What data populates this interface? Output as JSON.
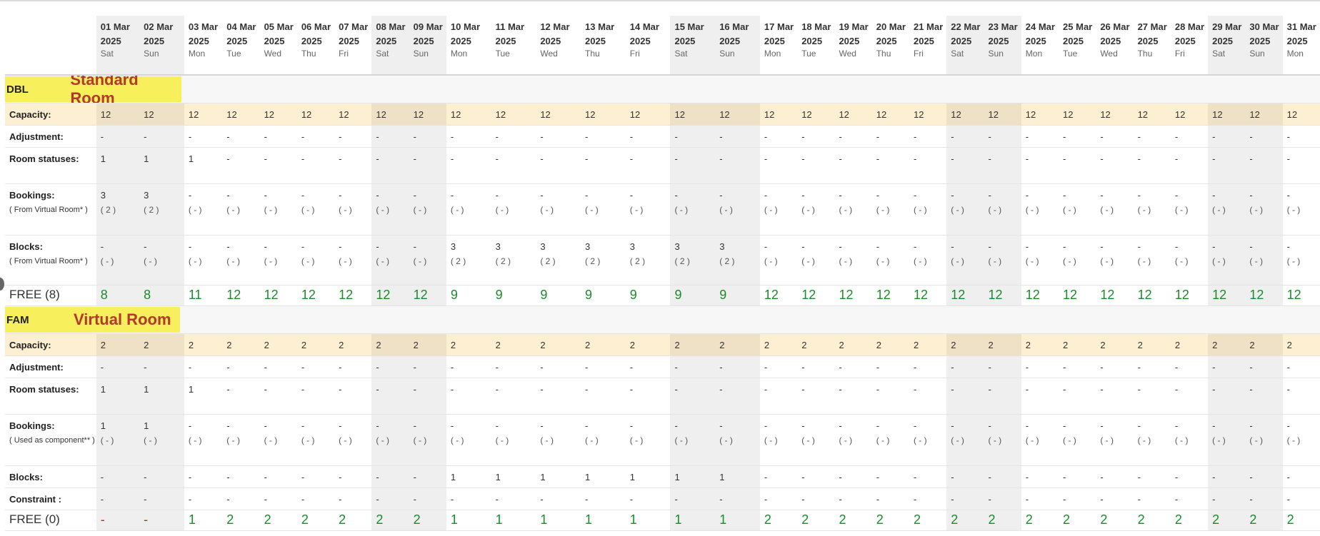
{
  "dates": [
    {
      "d": "01 Mar",
      "y": "2025",
      "w": "Sat",
      "wk": true
    },
    {
      "d": "02 Mar",
      "y": "2025",
      "w": "Sun",
      "wk": true
    },
    {
      "d": "03 Mar",
      "y": "2025",
      "w": "Mon",
      "wk": false
    },
    {
      "d": "04 Mar",
      "y": "2025",
      "w": "Tue",
      "wk": false
    },
    {
      "d": "05 Mar",
      "y": "2025",
      "w": "Wed",
      "wk": false
    },
    {
      "d": "06 Mar",
      "y": "2025",
      "w": "Thu",
      "wk": false
    },
    {
      "d": "07 Mar",
      "y": "2025",
      "w": "Fri",
      "wk": false
    },
    {
      "d": "08 Mar",
      "y": "2025",
      "w": "Sat",
      "wk": true
    },
    {
      "d": "09 Mar",
      "y": "2025",
      "w": "Sun",
      "wk": true
    },
    {
      "d": "10 Mar",
      "y": "2025",
      "w": "Mon",
      "wk": false
    },
    {
      "d": "11 Mar",
      "y": "2025",
      "w": "Tue",
      "wk": false
    },
    {
      "d": "12 Mar",
      "y": "2025",
      "w": "Wed",
      "wk": false
    },
    {
      "d": "13 Mar",
      "y": "2025",
      "w": "Thu",
      "wk": false
    },
    {
      "d": "14 Mar",
      "y": "2025",
      "w": "Fri",
      "wk": false
    },
    {
      "d": "15 Mar",
      "y": "2025",
      "w": "Sat",
      "wk": true
    },
    {
      "d": "16 Mar",
      "y": "2025",
      "w": "Sun",
      "wk": true
    },
    {
      "d": "17 Mar",
      "y": "2025",
      "w": "Mon",
      "wk": false
    },
    {
      "d": "18 Mar",
      "y": "2025",
      "w": "Tue",
      "wk": false
    },
    {
      "d": "19 Mar",
      "y": "2025",
      "w": "Wed",
      "wk": false
    },
    {
      "d": "20 Mar",
      "y": "2025",
      "w": "Thu",
      "wk": false
    },
    {
      "d": "21 Mar",
      "y": "2025",
      "w": "Fri",
      "wk": false
    },
    {
      "d": "22 Mar",
      "y": "2025",
      "w": "Sat",
      "wk": true
    },
    {
      "d": "23 Mar",
      "y": "2025",
      "w": "Sun",
      "wk": true
    },
    {
      "d": "24 Mar",
      "y": "2025",
      "w": "Mon",
      "wk": false
    },
    {
      "d": "25 Mar",
      "y": "2025",
      "w": "Tue",
      "wk": false
    },
    {
      "d": "26 Mar",
      "y": "2025",
      "w": "Wed",
      "wk": false
    },
    {
      "d": "27 Mar",
      "y": "2025",
      "w": "Thu",
      "wk": false
    },
    {
      "d": "28 Mar",
      "y": "2025",
      "w": "Fri",
      "wk": false
    },
    {
      "d": "29 Mar",
      "y": "2025",
      "w": "Sat",
      "wk": true
    },
    {
      "d": "30 Mar",
      "y": "2025",
      "w": "Sun",
      "wk": true
    },
    {
      "d": "31 Mar",
      "y": "2025",
      "w": "Mon",
      "wk": false
    }
  ],
  "sections": [
    {
      "code": "DBL",
      "name": "Standard Room",
      "rows": [
        {
          "type": "cap",
          "label": "Capacity:",
          "values": [
            "12",
            "12",
            "12",
            "12",
            "12",
            "12",
            "12",
            "12",
            "12",
            "12",
            "12",
            "12",
            "12",
            "12",
            "12",
            "12",
            "12",
            "12",
            "12",
            "12",
            "12",
            "12",
            "12",
            "12",
            "12",
            "12",
            "12",
            "12",
            "12",
            "12",
            "12"
          ]
        },
        {
          "type": "plain",
          "label": "Adjustment:",
          "values": [
            "-",
            "-",
            "-",
            "-",
            "-",
            "-",
            "-",
            "-",
            "-",
            "-",
            "-",
            "-",
            "-",
            "-",
            "-",
            "-",
            "-",
            "-",
            "-",
            "-",
            "-",
            "-",
            "-",
            "-",
            "-",
            "-",
            "-",
            "-",
            "-",
            "-",
            "-"
          ]
        },
        {
          "type": "plain",
          "label": "Room statuses:",
          "values": [
            "1",
            "1",
            "1",
            "-",
            "-",
            "-",
            "-",
            "-",
            "-",
            "-",
            "-",
            "-",
            "-",
            "-",
            "-",
            "-",
            "-",
            "-",
            "-",
            "-",
            "-",
            "-",
            "-",
            "-",
            "-",
            "-",
            "-",
            "-",
            "-",
            "-",
            "-"
          ]
        },
        {
          "type": "sub",
          "label": "Bookings:",
          "sublabel": "( From Virtual Room* )",
          "values": [
            "3",
            "3",
            "-",
            "-",
            "-",
            "-",
            "-",
            "-",
            "-",
            "-",
            "-",
            "-",
            "-",
            "-",
            "-",
            "-",
            "-",
            "-",
            "-",
            "-",
            "-",
            "-",
            "-",
            "-",
            "-",
            "-",
            "-",
            "-",
            "-",
            "-",
            "-"
          ],
          "subs": [
            "( 2 )",
            "( 2 )",
            "( - )",
            "( - )",
            "( - )",
            "( - )",
            "( - )",
            "( - )",
            "( - )",
            "( - )",
            "( - )",
            "( - )",
            "( - )",
            "( - )",
            "( - )",
            "( - )",
            "( - )",
            "( - )",
            "( - )",
            "( - )",
            "( - )",
            "( - )",
            "( - )",
            "( - )",
            "( - )",
            "( - )",
            "( - )",
            "( - )",
            "( - )",
            "( - )",
            "( - )"
          ]
        },
        {
          "type": "sub",
          "label": "Blocks:",
          "sublabel": "( From Virtual Room* )",
          "values": [
            "-",
            "-",
            "-",
            "-",
            "-",
            "-",
            "-",
            "-",
            "-",
            "3",
            "3",
            "3",
            "3",
            "3",
            "3",
            "3",
            "-",
            "-",
            "-",
            "-",
            "-",
            "-",
            "-",
            "-",
            "-",
            "-",
            "-",
            "-",
            "-",
            "-",
            "-"
          ],
          "subs": [
            "( - )",
            "( - )",
            "( - )",
            "( - )",
            "( - )",
            "( - )",
            "( - )",
            "( - )",
            "( - )",
            "( 2 )",
            "( 2 )",
            "( 2 )",
            "( 2 )",
            "( 2 )",
            "( 2 )",
            "( 2 )",
            "( - )",
            "( - )",
            "( - )",
            "( - )",
            "( - )",
            "( - )",
            "( - )",
            "( - )",
            "( - )",
            "( - )",
            "( - )",
            "( - )",
            "( - )",
            "( - )",
            "( - )"
          ]
        },
        {
          "type": "free",
          "label": "FREE (8)",
          "values": [
            "8",
            "8",
            "11",
            "12",
            "12",
            "12",
            "12",
            "12",
            "12",
            "9",
            "9",
            "9",
            "9",
            "9",
            "9",
            "9",
            "12",
            "12",
            "12",
            "12",
            "12",
            "12",
            "12",
            "12",
            "12",
            "12",
            "12",
            "12",
            "12",
            "12",
            "12"
          ]
        }
      ]
    },
    {
      "code": "FAM",
      "name": "Virtual Room",
      "rows": [
        {
          "type": "cap",
          "label": "Capacity:",
          "values": [
            "2",
            "2",
            "2",
            "2",
            "2",
            "2",
            "2",
            "2",
            "2",
            "2",
            "2",
            "2",
            "2",
            "2",
            "2",
            "2",
            "2",
            "2",
            "2",
            "2",
            "2",
            "2",
            "2",
            "2",
            "2",
            "2",
            "2",
            "2",
            "2",
            "2",
            "2"
          ]
        },
        {
          "type": "plain",
          "label": "Adjustment:",
          "values": [
            "-",
            "-",
            "-",
            "-",
            "-",
            "-",
            "-",
            "-",
            "-",
            "-",
            "-",
            "-",
            "-",
            "-",
            "-",
            "-",
            "-",
            "-",
            "-",
            "-",
            "-",
            "-",
            "-",
            "-",
            "-",
            "-",
            "-",
            "-",
            "-",
            "-",
            "-"
          ]
        },
        {
          "type": "plain",
          "label": "Room statuses:",
          "values": [
            "1",
            "1",
            "1",
            "-",
            "-",
            "-",
            "-",
            "-",
            "-",
            "-",
            "-",
            "-",
            "-",
            "-",
            "-",
            "-",
            "-",
            "-",
            "-",
            "-",
            "-",
            "-",
            "-",
            "-",
            "-",
            "-",
            "-",
            "-",
            "-",
            "-",
            "-"
          ]
        },
        {
          "type": "sub",
          "label": "Bookings:",
          "sublabel": "( Used as component** )",
          "values": [
            "1",
            "1",
            "-",
            "-",
            "-",
            "-",
            "-",
            "-",
            "-",
            "-",
            "-",
            "-",
            "-",
            "-",
            "-",
            "-",
            "-",
            "-",
            "-",
            "-",
            "-",
            "-",
            "-",
            "-",
            "-",
            "-",
            "-",
            "-",
            "-",
            "-",
            "-"
          ],
          "subs": [
            "( - )",
            "( - )",
            "( - )",
            "( - )",
            "( - )",
            "( - )",
            "( - )",
            "( - )",
            "( - )",
            "( - )",
            "( - )",
            "( - )",
            "( - )",
            "( - )",
            "( - )",
            "( - )",
            "( - )",
            "( - )",
            "( - )",
            "( - )",
            "( - )",
            "( - )",
            "( - )",
            "( - )",
            "( - )",
            "( - )",
            "( - )",
            "( - )",
            "( - )",
            "( - )",
            "( - )"
          ]
        },
        {
          "type": "plain",
          "label": "Blocks:",
          "values": [
            "-",
            "-",
            "-",
            "-",
            "-",
            "-",
            "-",
            "-",
            "-",
            "1",
            "1",
            "1",
            "1",
            "1",
            "1",
            "1",
            "-",
            "-",
            "-",
            "-",
            "-",
            "-",
            "-",
            "-",
            "-",
            "-",
            "-",
            "-",
            "-",
            "-",
            "-"
          ]
        },
        {
          "type": "plain",
          "label": "Constraint :",
          "values": [
            "-",
            "-",
            "-",
            "-",
            "-",
            "-",
            "-",
            "-",
            "-",
            "-",
            "-",
            "-",
            "-",
            "-",
            "-",
            "-",
            "-",
            "-",
            "-",
            "-",
            "-",
            "-",
            "-",
            "-",
            "-",
            "-",
            "-",
            "-",
            "-",
            "-",
            "-"
          ]
        },
        {
          "type": "free",
          "label": "FREE (0)",
          "values": [
            "-",
            "-",
            "1",
            "2",
            "2",
            "2",
            "2",
            "2",
            "2",
            "1",
            "1",
            "1",
            "1",
            "1",
            "1",
            "1",
            "2",
            "2",
            "2",
            "2",
            "2",
            "2",
            "2",
            "2",
            "2",
            "2",
            "2",
            "2",
            "2",
            "2",
            "2"
          ],
          "negative": [
            true,
            true,
            false,
            false,
            false,
            false,
            false,
            false,
            false,
            false,
            false,
            false,
            false,
            false,
            false,
            false,
            false,
            false,
            false,
            false,
            false,
            false,
            false,
            false,
            false,
            false,
            false,
            false,
            false,
            false,
            false
          ]
        }
      ]
    }
  ]
}
